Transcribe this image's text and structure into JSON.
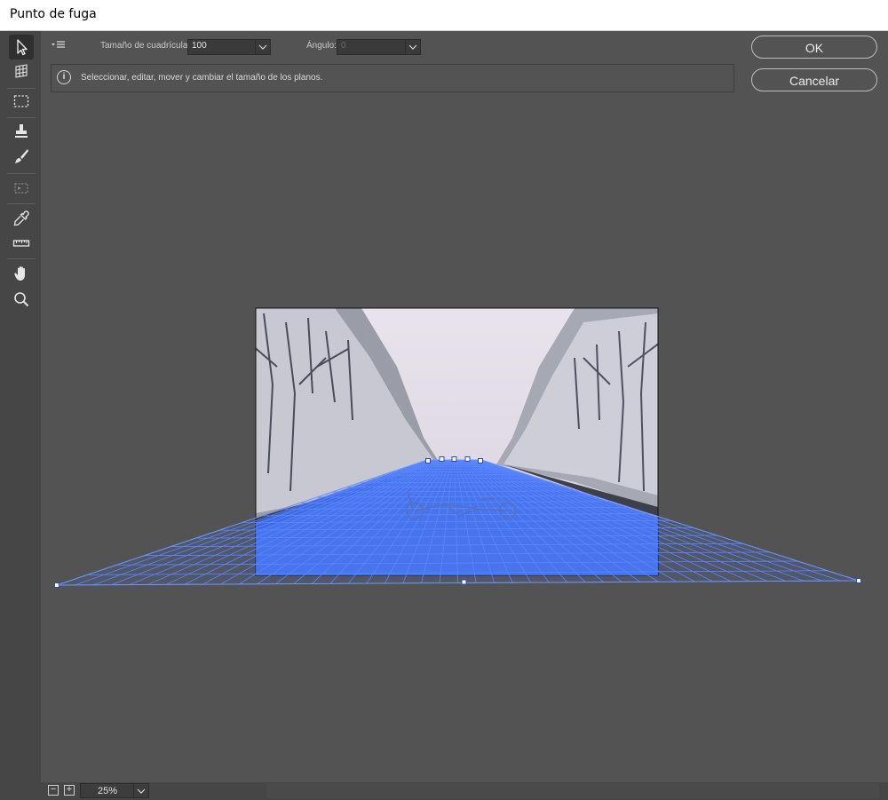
{
  "window": {
    "title": "Punto de fuga"
  },
  "tools": [
    {
      "name": "edit-plane-tool",
      "icon": "arrow-cursor-icon",
      "selected": true
    },
    {
      "name": "create-plane-tool",
      "icon": "grid-plane-icon"
    },
    {
      "name": "marquee-tool",
      "icon": "dashed-rect-icon"
    },
    {
      "name": "stamp-tool",
      "icon": "stamp-icon"
    },
    {
      "name": "brush-tool",
      "icon": "brush-icon"
    },
    {
      "name": "transform-tool",
      "icon": "transform-icon"
    },
    {
      "name": "eyedropper-tool",
      "icon": "eyedropper-icon"
    },
    {
      "name": "measure-tool",
      "icon": "ruler-icon"
    },
    {
      "name": "hand-tool",
      "icon": "hand-icon"
    },
    {
      "name": "zoom-tool",
      "icon": "magnifier-icon"
    }
  ],
  "options": {
    "grid_size_label": "Tamaño de cuadrícula:",
    "grid_size_value": "100",
    "angle_label": "Ángulo:",
    "angle_value": "0"
  },
  "info": {
    "text": "Seleccionar, editar, mover y cambiar el tamaño de los planos."
  },
  "buttons": {
    "ok": "OK",
    "cancel": "Cancelar"
  },
  "status": {
    "zoom": "25%",
    "zoom_out": "−",
    "zoom_in": "+"
  },
  "colors": {
    "grid_blue": "#4a7aff",
    "road_fill": "#3f6ef0"
  }
}
